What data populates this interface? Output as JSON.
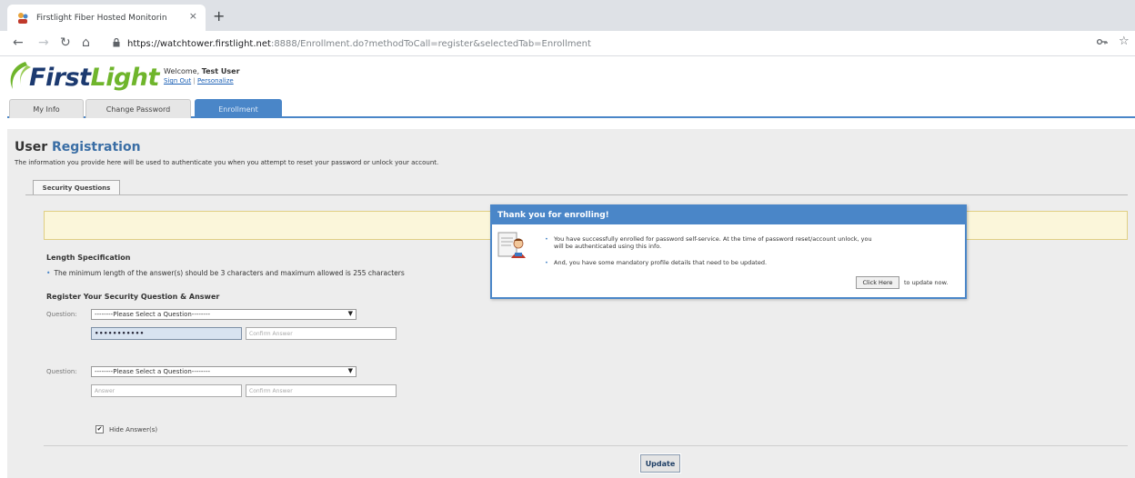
{
  "browser": {
    "tab_title": "Firstlight Fiber Hosted Monitorin",
    "tab_close": "×",
    "new_tab": "+",
    "url_host": "https://watchtower.firstlight.net",
    "url_rest": ":8888/Enrollment.do?methodToCall=register&selectedTab=Enrollment",
    "icons": {
      "back": "back-arrow-icon",
      "forward": "forward-arrow-icon",
      "reload": "reload-icon",
      "home": "home-icon",
      "lock": "lock-icon",
      "key": "key-icon",
      "star": "star-icon"
    }
  },
  "header": {
    "logo_first": "First",
    "logo_light": "Light",
    "welcome_prefix": "Welcome,",
    "user_name": "Test User",
    "sign_out": "Sign Out",
    "link_separator": "|",
    "personalize": "Personalize"
  },
  "tabs": [
    {
      "label": "My Info",
      "active": false
    },
    {
      "label": "Change Password",
      "active": false
    },
    {
      "label": "Enrollment",
      "active": true
    }
  ],
  "page": {
    "title_user": "User",
    "title_registration": "Registration",
    "description": "The information you provide here will be used to authenticate you when you attempt to reset your password or unlock your account.",
    "subtab": "Security Questions",
    "length_heading": "Length Specification",
    "length_rule": "The minimum length of the answer(s) should be 3 characters and maximum allowed is 255 characters",
    "register_heading": "Register Your Security Question & Answer",
    "questions": [
      {
        "label": "Question:",
        "selected": "--------Please Select a Question--------",
        "answer_value": "•••••••••••",
        "answer_placeholder": "Answer",
        "confirm_placeholder": "Confirm Answer"
      },
      {
        "label": "Question:",
        "selected": "--------Please Select a Question--------",
        "answer_value": "",
        "answer_placeholder": "Answer",
        "confirm_placeholder": "Confirm Answer"
      }
    ],
    "hide_answers_label": "Hide Answer(s)",
    "hide_answers_checked": true,
    "update_button": "Update"
  },
  "modal": {
    "title": "Thank you for enrolling!",
    "messages": [
      "You have successfully enrolled for password self-service. At the time of password reset/account unlock, you will be authenticated using this info.",
      "And, you have some mandatory profile details that need to be updated."
    ],
    "click_here": "Click Here",
    "update_now": "to update now."
  },
  "colors": {
    "accent_blue": "#4a86c8",
    "logo_navy": "#1c3a70",
    "logo_green": "#6fb52c",
    "message_bar": "#fbf6da"
  }
}
